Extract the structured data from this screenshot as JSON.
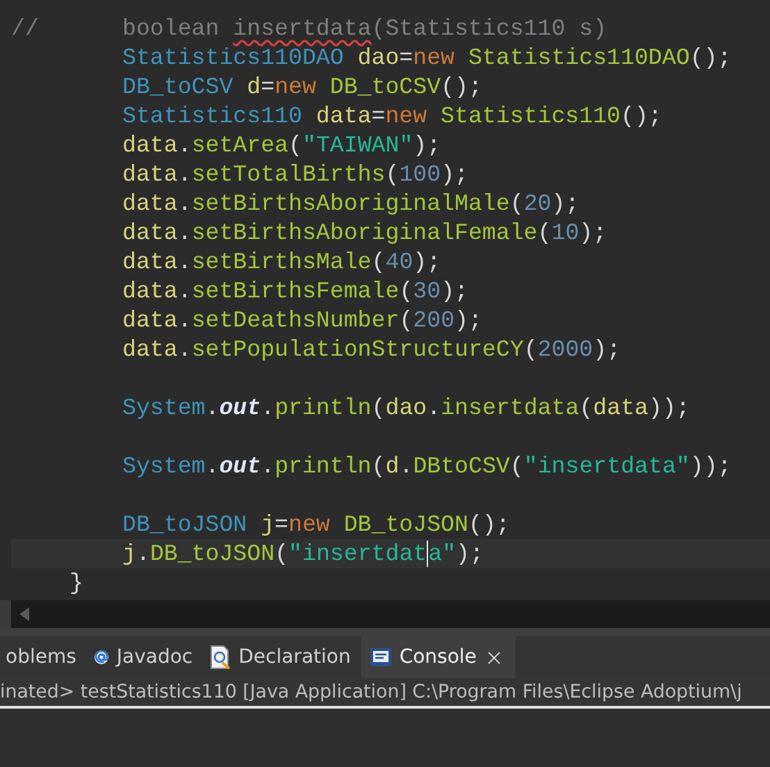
{
  "editor": {
    "lines": [
      {
        "kind": "commented",
        "marker": "//",
        "tokens": [
          {
            "kind": "comment",
            "text": "boolean "
          },
          {
            "kind": "comment",
            "text": "insertdata",
            "warning": true
          },
          {
            "kind": "comment",
            "text": "(Statistics110 s)"
          }
        ]
      },
      {
        "kind": "body",
        "tokens": [
          {
            "kind": "type",
            "text": "Statistics110DAO"
          },
          {
            "kind": "var",
            "text": " dao"
          },
          {
            "kind": "punct",
            "text": "="
          },
          {
            "kind": "keyword",
            "text": "new"
          },
          {
            "kind": "method",
            "text": " Statistics110DAO"
          },
          {
            "kind": "punct",
            "text": "();"
          }
        ]
      },
      {
        "kind": "body",
        "tokens": [
          {
            "kind": "type",
            "text": "DB_toCSV"
          },
          {
            "kind": "var",
            "text": " d"
          },
          {
            "kind": "punct",
            "text": "="
          },
          {
            "kind": "keyword",
            "text": "new"
          },
          {
            "kind": "method",
            "text": " DB_toCSV"
          },
          {
            "kind": "punct",
            "text": "();"
          }
        ]
      },
      {
        "kind": "body",
        "tokens": [
          {
            "kind": "type",
            "text": "Statistics110"
          },
          {
            "kind": "var",
            "text": " data"
          },
          {
            "kind": "punct",
            "text": "="
          },
          {
            "kind": "keyword",
            "text": "new"
          },
          {
            "kind": "method",
            "text": " Statistics110"
          },
          {
            "kind": "punct",
            "text": "();"
          }
        ]
      },
      {
        "kind": "body",
        "tokens": [
          {
            "kind": "var",
            "text": "data"
          },
          {
            "kind": "punct",
            "text": "."
          },
          {
            "kind": "method",
            "text": "setArea"
          },
          {
            "kind": "punct",
            "text": "("
          },
          {
            "kind": "string",
            "text": "\"TAIWAN\""
          },
          {
            "kind": "punct",
            "text": ");"
          }
        ]
      },
      {
        "kind": "body",
        "tokens": [
          {
            "kind": "var",
            "text": "data"
          },
          {
            "kind": "punct",
            "text": "."
          },
          {
            "kind": "method",
            "text": "setTotalBirths"
          },
          {
            "kind": "punct",
            "text": "("
          },
          {
            "kind": "number",
            "text": "100"
          },
          {
            "kind": "punct",
            "text": ");"
          }
        ]
      },
      {
        "kind": "body",
        "tokens": [
          {
            "kind": "var",
            "text": "data"
          },
          {
            "kind": "punct",
            "text": "."
          },
          {
            "kind": "method",
            "text": "setBirthsAboriginalMale"
          },
          {
            "kind": "punct",
            "text": "("
          },
          {
            "kind": "number",
            "text": "20"
          },
          {
            "kind": "punct",
            "text": ");"
          }
        ]
      },
      {
        "kind": "body",
        "tokens": [
          {
            "kind": "var",
            "text": "data"
          },
          {
            "kind": "punct",
            "text": "."
          },
          {
            "kind": "method",
            "text": "setBirthsAboriginalFemale"
          },
          {
            "kind": "punct",
            "text": "("
          },
          {
            "kind": "number",
            "text": "10"
          },
          {
            "kind": "punct",
            "text": ");"
          }
        ]
      },
      {
        "kind": "body",
        "tokens": [
          {
            "kind": "var",
            "text": "data"
          },
          {
            "kind": "punct",
            "text": "."
          },
          {
            "kind": "method",
            "text": "setBirthsMale"
          },
          {
            "kind": "punct",
            "text": "("
          },
          {
            "kind": "number",
            "text": "40"
          },
          {
            "kind": "punct",
            "text": ");"
          }
        ]
      },
      {
        "kind": "body",
        "tokens": [
          {
            "kind": "var",
            "text": "data"
          },
          {
            "kind": "punct",
            "text": "."
          },
          {
            "kind": "method",
            "text": "setBirthsFemale"
          },
          {
            "kind": "punct",
            "text": "("
          },
          {
            "kind": "number",
            "text": "30"
          },
          {
            "kind": "punct",
            "text": ");"
          }
        ]
      },
      {
        "kind": "body",
        "tokens": [
          {
            "kind": "var",
            "text": "data"
          },
          {
            "kind": "punct",
            "text": "."
          },
          {
            "kind": "method",
            "text": "setDeathsNumber"
          },
          {
            "kind": "punct",
            "text": "("
          },
          {
            "kind": "number",
            "text": "200"
          },
          {
            "kind": "punct",
            "text": ");"
          }
        ]
      },
      {
        "kind": "body",
        "tokens": [
          {
            "kind": "var",
            "text": "data"
          },
          {
            "kind": "punct",
            "text": "."
          },
          {
            "kind": "method",
            "text": "setPopulationStructureCY"
          },
          {
            "kind": "punct",
            "text": "("
          },
          {
            "kind": "number",
            "text": "2000"
          },
          {
            "kind": "punct",
            "text": ");"
          }
        ]
      },
      {
        "kind": "blank"
      },
      {
        "kind": "body",
        "tokens": [
          {
            "kind": "type",
            "text": "System"
          },
          {
            "kind": "punct",
            "text": "."
          },
          {
            "kind": "static",
            "text": "out"
          },
          {
            "kind": "punct",
            "text": "."
          },
          {
            "kind": "method",
            "text": "println"
          },
          {
            "kind": "punct",
            "text": "("
          },
          {
            "kind": "var",
            "text": "dao"
          },
          {
            "kind": "punct",
            "text": "."
          },
          {
            "kind": "method",
            "text": "insertdata"
          },
          {
            "kind": "punct",
            "text": "("
          },
          {
            "kind": "var",
            "text": "data"
          },
          {
            "kind": "punct",
            "text": "));"
          }
        ]
      },
      {
        "kind": "blank"
      },
      {
        "kind": "body",
        "tokens": [
          {
            "kind": "type",
            "text": "System"
          },
          {
            "kind": "punct",
            "text": "."
          },
          {
            "kind": "static",
            "text": "out"
          },
          {
            "kind": "punct",
            "text": "."
          },
          {
            "kind": "method",
            "text": "println"
          },
          {
            "kind": "punct",
            "text": "("
          },
          {
            "kind": "var",
            "text": "d"
          },
          {
            "kind": "punct",
            "text": "."
          },
          {
            "kind": "method",
            "text": "DBtoCSV"
          },
          {
            "kind": "punct",
            "text": "("
          },
          {
            "kind": "string",
            "text": "\"insertdata\""
          },
          {
            "kind": "punct",
            "text": "));"
          }
        ]
      },
      {
        "kind": "blank"
      },
      {
        "kind": "body",
        "tokens": [
          {
            "kind": "type",
            "text": "DB_toJSON"
          },
          {
            "kind": "var",
            "text": " j"
          },
          {
            "kind": "punct",
            "text": "="
          },
          {
            "kind": "keyword",
            "text": "new"
          },
          {
            "kind": "method",
            "text": " DB_toJSON"
          },
          {
            "kind": "punct",
            "text": "();"
          }
        ]
      },
      {
        "kind": "body",
        "current": true,
        "tokens": [
          {
            "kind": "var",
            "text": "j"
          },
          {
            "kind": "punct",
            "text": "."
          },
          {
            "kind": "method",
            "text": "DB_toJSON"
          },
          {
            "kind": "punct",
            "text": "("
          },
          {
            "kind": "string",
            "text": "\"insertdat",
            "caret": true
          },
          {
            "kind": "string",
            "text": "a\""
          },
          {
            "kind": "punct",
            "text": ");"
          }
        ]
      },
      {
        "kind": "brace",
        "tokens": [
          {
            "kind": "punct",
            "text": "}"
          }
        ]
      }
    ]
  },
  "panel": {
    "tabs": [
      {
        "kind": "problems",
        "label": "oblems",
        "selected": false
      },
      {
        "kind": "javadoc",
        "label": "Javadoc",
        "selected": false
      },
      {
        "kind": "declaration",
        "label": "Declaration",
        "selected": false
      },
      {
        "kind": "console",
        "label": "Console",
        "selected": true,
        "closable": true
      }
    ],
    "console_title": "inated> testStatistics110 [Java Application] C:\\Program Files\\Eclipse Adoptium\\j"
  }
}
